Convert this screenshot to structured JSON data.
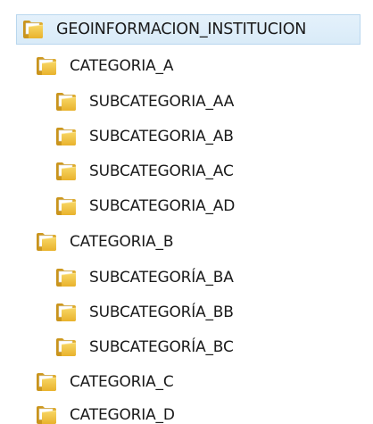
{
  "tree": {
    "root": {
      "label": "GEOINFORMACION_INSTITUCION"
    },
    "categories": [
      {
        "label": "CATEGORIA_A",
        "children": [
          {
            "label": "SUBCATEGORIA_AA"
          },
          {
            "label": "SUBCATEGORIA_AB"
          },
          {
            "label": "SUBCATEGORIA_AC"
          },
          {
            "label": "SUBCATEGORIA_AD"
          }
        ]
      },
      {
        "label": "CATEGORIA_B",
        "children": [
          {
            "label": "SUBCATEGORÍA_BA"
          },
          {
            "label": "SUBCATEGORÍA_BB"
          },
          {
            "label": "SUBCATEGORÍA_BC"
          }
        ]
      },
      {
        "label": "CATEGORIA_C",
        "children": []
      },
      {
        "label": "CATEGORIA_D",
        "children": []
      }
    ]
  },
  "colors": {
    "selection_background": "#dcecf8",
    "selection_border": "#b9d7ee",
    "folder_body": "#f3c74a",
    "folder_back": "#d9a521",
    "folder_paper": "#ffffff"
  },
  "icons": {
    "folder": "folder-icon"
  }
}
